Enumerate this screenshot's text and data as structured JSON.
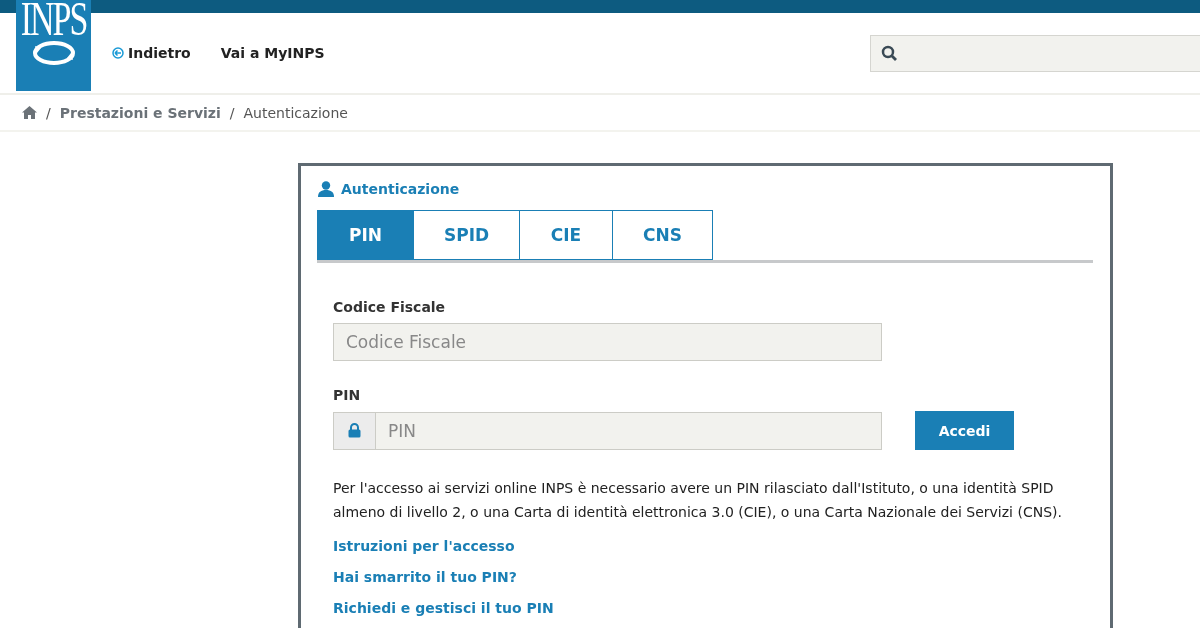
{
  "header": {
    "logo_text": "INPS",
    "nav": [
      {
        "label": "Indietro",
        "kind": "back"
      },
      {
        "label": "Vai a MyINPS",
        "kind": "plain"
      }
    ]
  },
  "breadcrumb": [
    {
      "separator": "/",
      "label": "Prestazioni e Servizi",
      "kind": "link"
    },
    {
      "separator": "/",
      "label": "Autenticazione",
      "kind": "current"
    }
  ],
  "auth": {
    "title": "Autenticazione",
    "tabs": [
      {
        "label": "PIN",
        "selected": true
      },
      {
        "label": "SPID",
        "selected": false
      },
      {
        "label": "CIE",
        "selected": false
      },
      {
        "label": "CNS",
        "selected": false
      }
    ],
    "fields": [
      {
        "label": "Codice Fiscale",
        "placeholder": "Codice Fiscale",
        "kind": "text"
      },
      {
        "label": "PIN",
        "placeholder": "PIN",
        "kind": "locked"
      }
    ],
    "submit": "Accedi",
    "info": "Per l'accesso ai servizi online INPS è necessario avere un PIN rilasciato dall'Istituto, o una identità SPID almeno di livello 2, o una Carta di identità elettronica 3.0 (CIE), o una Carta Nazionale dei Servizi (CNS).",
    "links": [
      "Istruzioni per l'accesso",
      "Hai smarrito il tuo PIN?",
      "Richiedi e gestisci il tuo PIN"
    ]
  }
}
